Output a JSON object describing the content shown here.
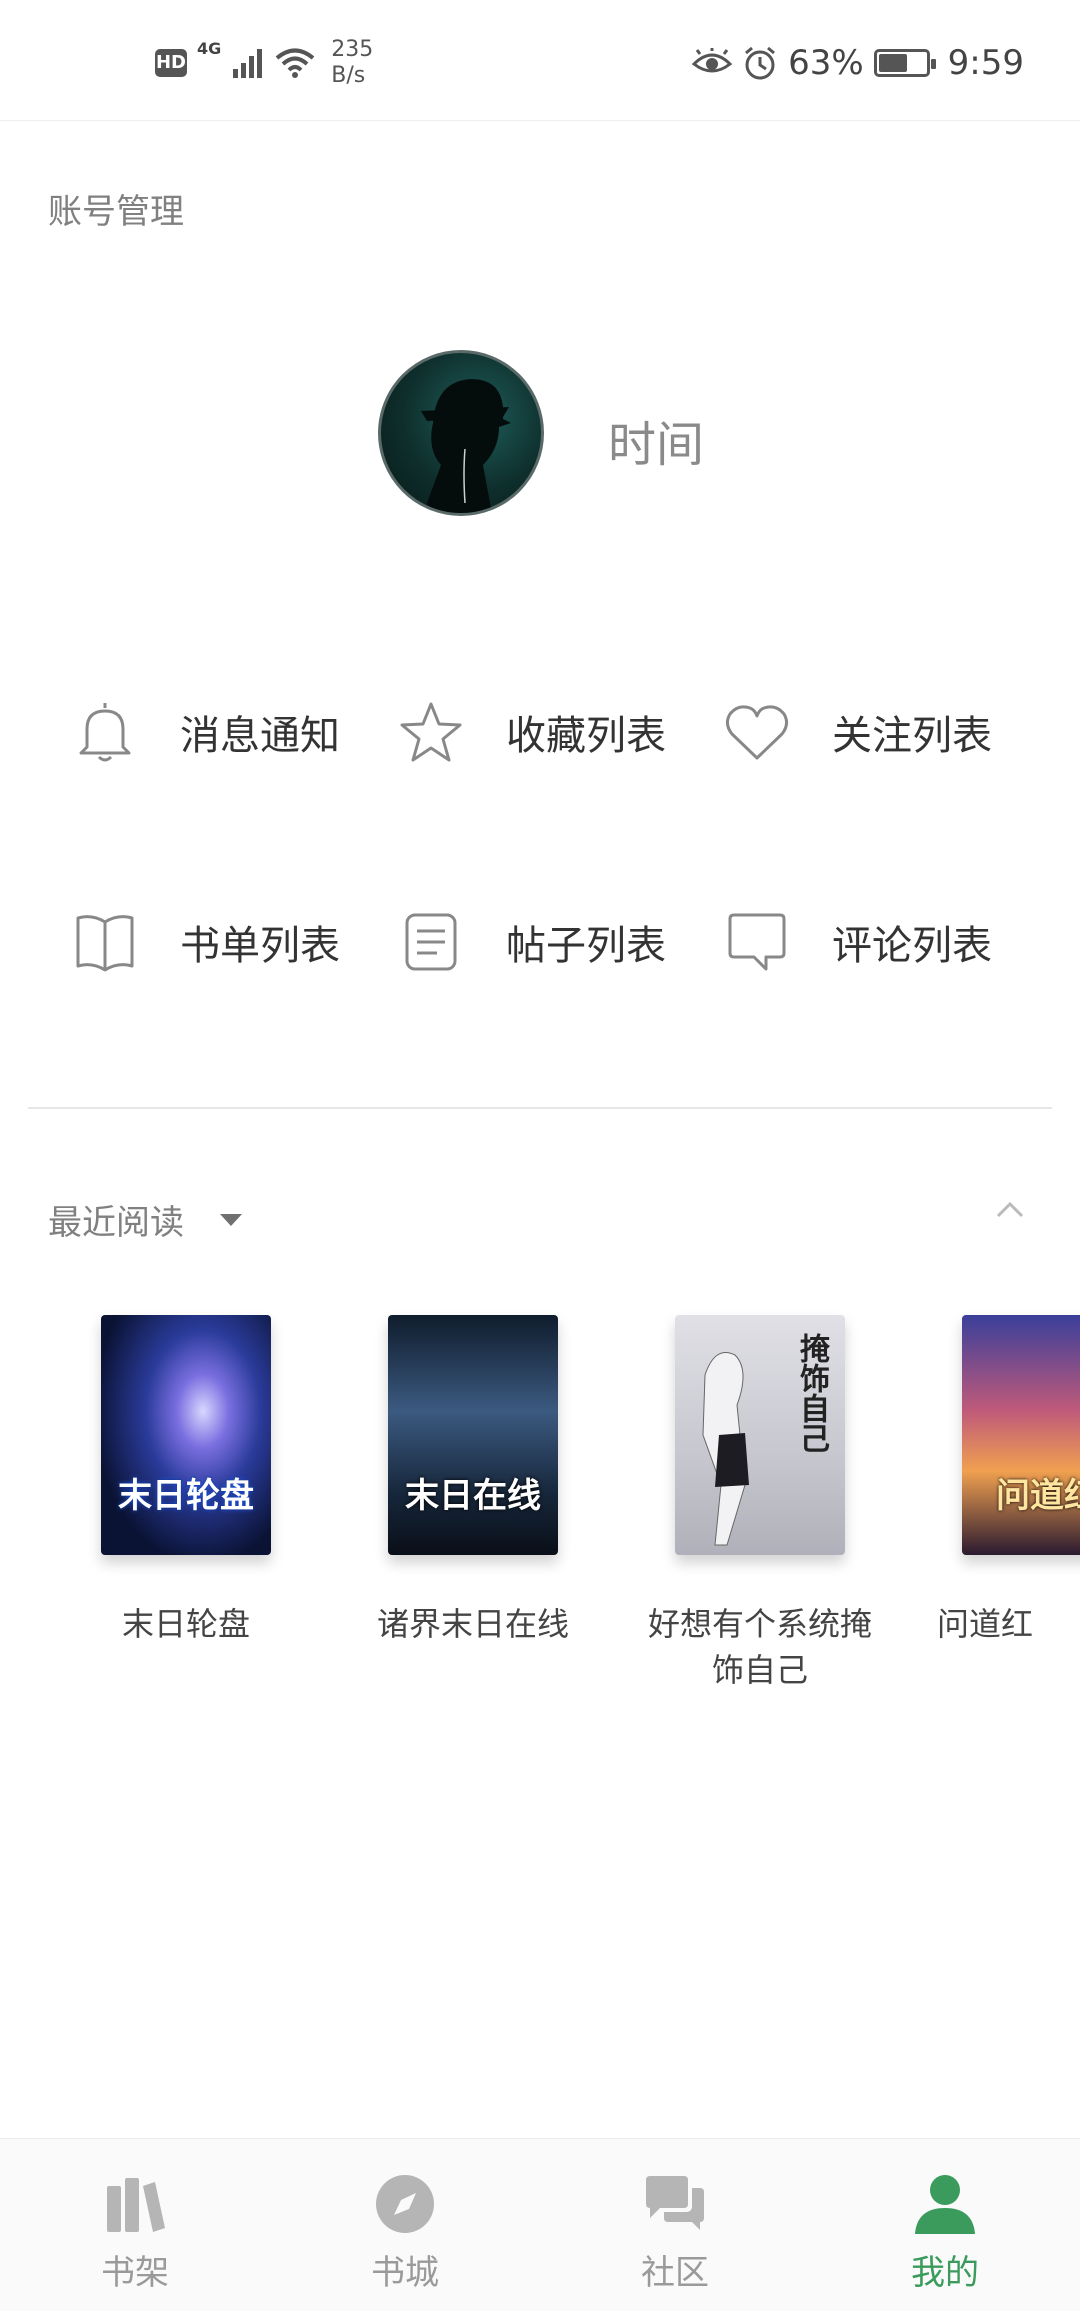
{
  "status_bar": {
    "hd_label": "HD",
    "network_label": "4G",
    "speed_value": "235",
    "speed_unit": "B/s",
    "battery_percent": "63%",
    "battery_level": 0.63,
    "time": "9:59",
    "icons": [
      "signal-icon",
      "wifi-icon",
      "eye-icon",
      "alarm-icon",
      "battery-icon"
    ]
  },
  "account_section": {
    "title": "账号管理",
    "username": "时间"
  },
  "menu": [
    {
      "label": "消息通知",
      "icon": "bell-icon"
    },
    {
      "label": "收藏列表",
      "icon": "star-icon"
    },
    {
      "label": "关注列表",
      "icon": "heart-icon"
    },
    {
      "label": "书单列表",
      "icon": "book-icon"
    },
    {
      "label": "帖子列表",
      "icon": "document-icon"
    },
    {
      "label": "评论列表",
      "icon": "comment-icon"
    }
  ],
  "recent": {
    "title": "最近阅读",
    "books": [
      {
        "title": "末日轮盘",
        "cover_text": "末日轮盘",
        "cover_color": "#1a2a6c"
      },
      {
        "title": "诸界末日在线",
        "cover_text": "末日在线",
        "cover_color": "#1b2d45"
      },
      {
        "title": "好想有个系统掩饰自己",
        "cover_text": "掩饰自己",
        "cover_color": "#c9c9cf"
      },
      {
        "title": "问道红",
        "cover_text": "问道红",
        "cover_color": "#7a3a5a"
      }
    ]
  },
  "bottom_nav": [
    {
      "label": "书架",
      "icon": "bookshelf-icon",
      "active": false
    },
    {
      "label": "书城",
      "icon": "compass-icon",
      "active": false
    },
    {
      "label": "社区",
      "icon": "chat-icon",
      "active": false
    },
    {
      "label": "我的",
      "icon": "user-icon",
      "active": true
    }
  ],
  "colors": {
    "accent": "#3a9b5c",
    "muted": "#9a9a9a"
  }
}
